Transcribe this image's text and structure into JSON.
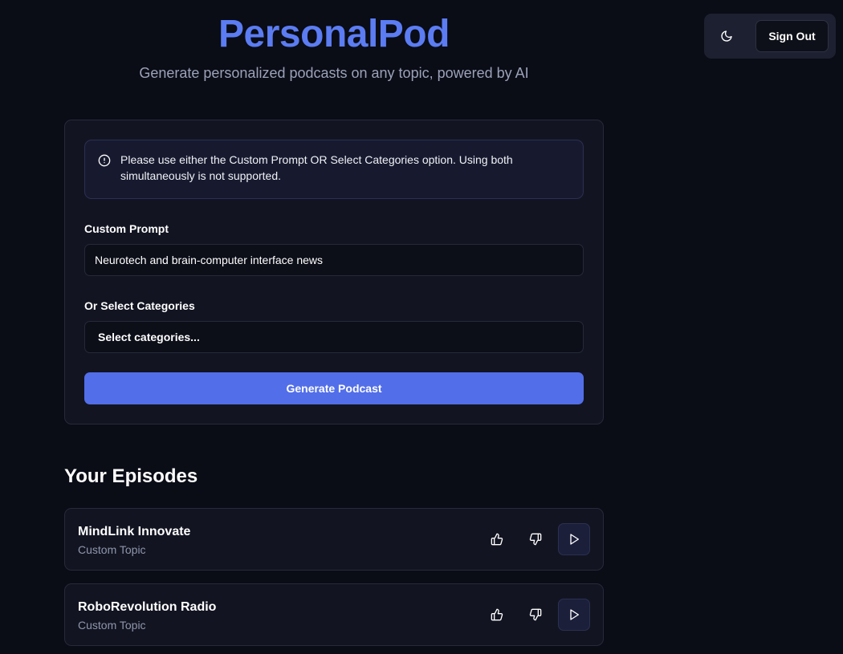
{
  "header": {
    "title": "PersonalPod",
    "subtitle": "Generate personalized podcasts on any topic, powered by AI",
    "theme_toggle_icon": "moon-icon",
    "sign_out_label": "Sign Out"
  },
  "form": {
    "notice": {
      "icon": "info-circle-icon",
      "text": "Please use either the Custom Prompt OR Select Categories option. Using both simultaneously is not supported."
    },
    "custom_prompt": {
      "label": "Custom Prompt",
      "value": "Neurotech and brain-computer interface news"
    },
    "categories": {
      "label": "Or Select Categories",
      "placeholder": "Select categories..."
    },
    "generate_label": "Generate Podcast"
  },
  "episodes": {
    "heading": "Your Episodes",
    "items": [
      {
        "title": "MindLink Innovate",
        "subtitle": "Custom Topic"
      },
      {
        "title": "RoboRevolution Radio",
        "subtitle": "Custom Topic"
      }
    ]
  },
  "colors": {
    "background": "#0a0c16",
    "brand": "#5b7cf2",
    "primary_button": "#526ee9",
    "card": "#121421"
  }
}
